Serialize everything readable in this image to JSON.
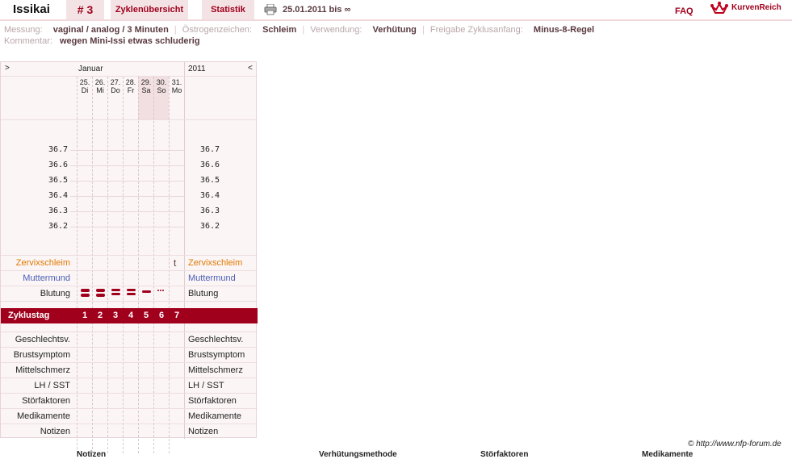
{
  "header": {
    "name": "Issikai",
    "cycle": "# 3",
    "tab_overview": "Zyklenübersicht",
    "tab_stats": "Statistik",
    "date_range": "25.01.2011 bis ∞",
    "faq": "FAQ",
    "brand": "KurvenReich"
  },
  "info": {
    "messung_label": "Messung:",
    "messung_value": "vaginal / analog / 3 Minuten",
    "oestrogen_label": "Östrogenzeichen:",
    "oestrogen_value": "Schleim",
    "verwendung_label": "Verwendung:",
    "verwendung_value": "Verhütung",
    "freigabe_label": "Freigabe Zyklusanfang:",
    "freigabe_value": "Minus-8-Regel",
    "kommentar_label": "Kommentar:",
    "kommentar_value": "wegen Mini-Issi etwas schluderig"
  },
  "chart": {
    "nav_prev": ">",
    "nav_next": "<",
    "month": "Januar",
    "year": "2011",
    "days": [
      {
        "num": "25.",
        "wd": "Di"
      },
      {
        "num": "26.",
        "wd": "Mi"
      },
      {
        "num": "27.",
        "wd": "Do"
      },
      {
        "num": "28.",
        "wd": "Fr"
      },
      {
        "num": "29.",
        "wd": "Sa"
      },
      {
        "num": "30.",
        "wd": "So"
      },
      {
        "num": "31.",
        "wd": "Mo"
      }
    ],
    "temps": [
      "36.7",
      "36.6",
      "36.5",
      "36.4",
      "36.3",
      "36.2"
    ],
    "rows": {
      "zervix": "Zervixschleim",
      "mutter": "Muttermund",
      "blutung": "Blutung",
      "zyklustag": "Zyklustag",
      "gv": "Geschlechtsv.",
      "brust": "Brustsymptom",
      "mittel": "Mittelschmerz",
      "lh": "LH / SST",
      "stoer": "Störfaktoren",
      "medi": "Medikamente",
      "notizen": "Notizen"
    },
    "zervix_mark": "t",
    "cycle_days": [
      "1",
      "2",
      "3",
      "4",
      "5",
      "6",
      "7"
    ],
    "bleeding": [
      "heavy",
      "heavy",
      "medium",
      "medium",
      "light",
      "spotting",
      "none"
    ]
  },
  "footer": {
    "copyright": "© http://www.nfp-forum.de",
    "col1": "Notizen",
    "col2": "Verhütungsmethode",
    "col3": "Störfaktoren",
    "col4": "Medikamente"
  },
  "colors": {
    "accent": "#a0001c",
    "zervix": "#e07a00",
    "mutter": "#4a5fb5"
  }
}
